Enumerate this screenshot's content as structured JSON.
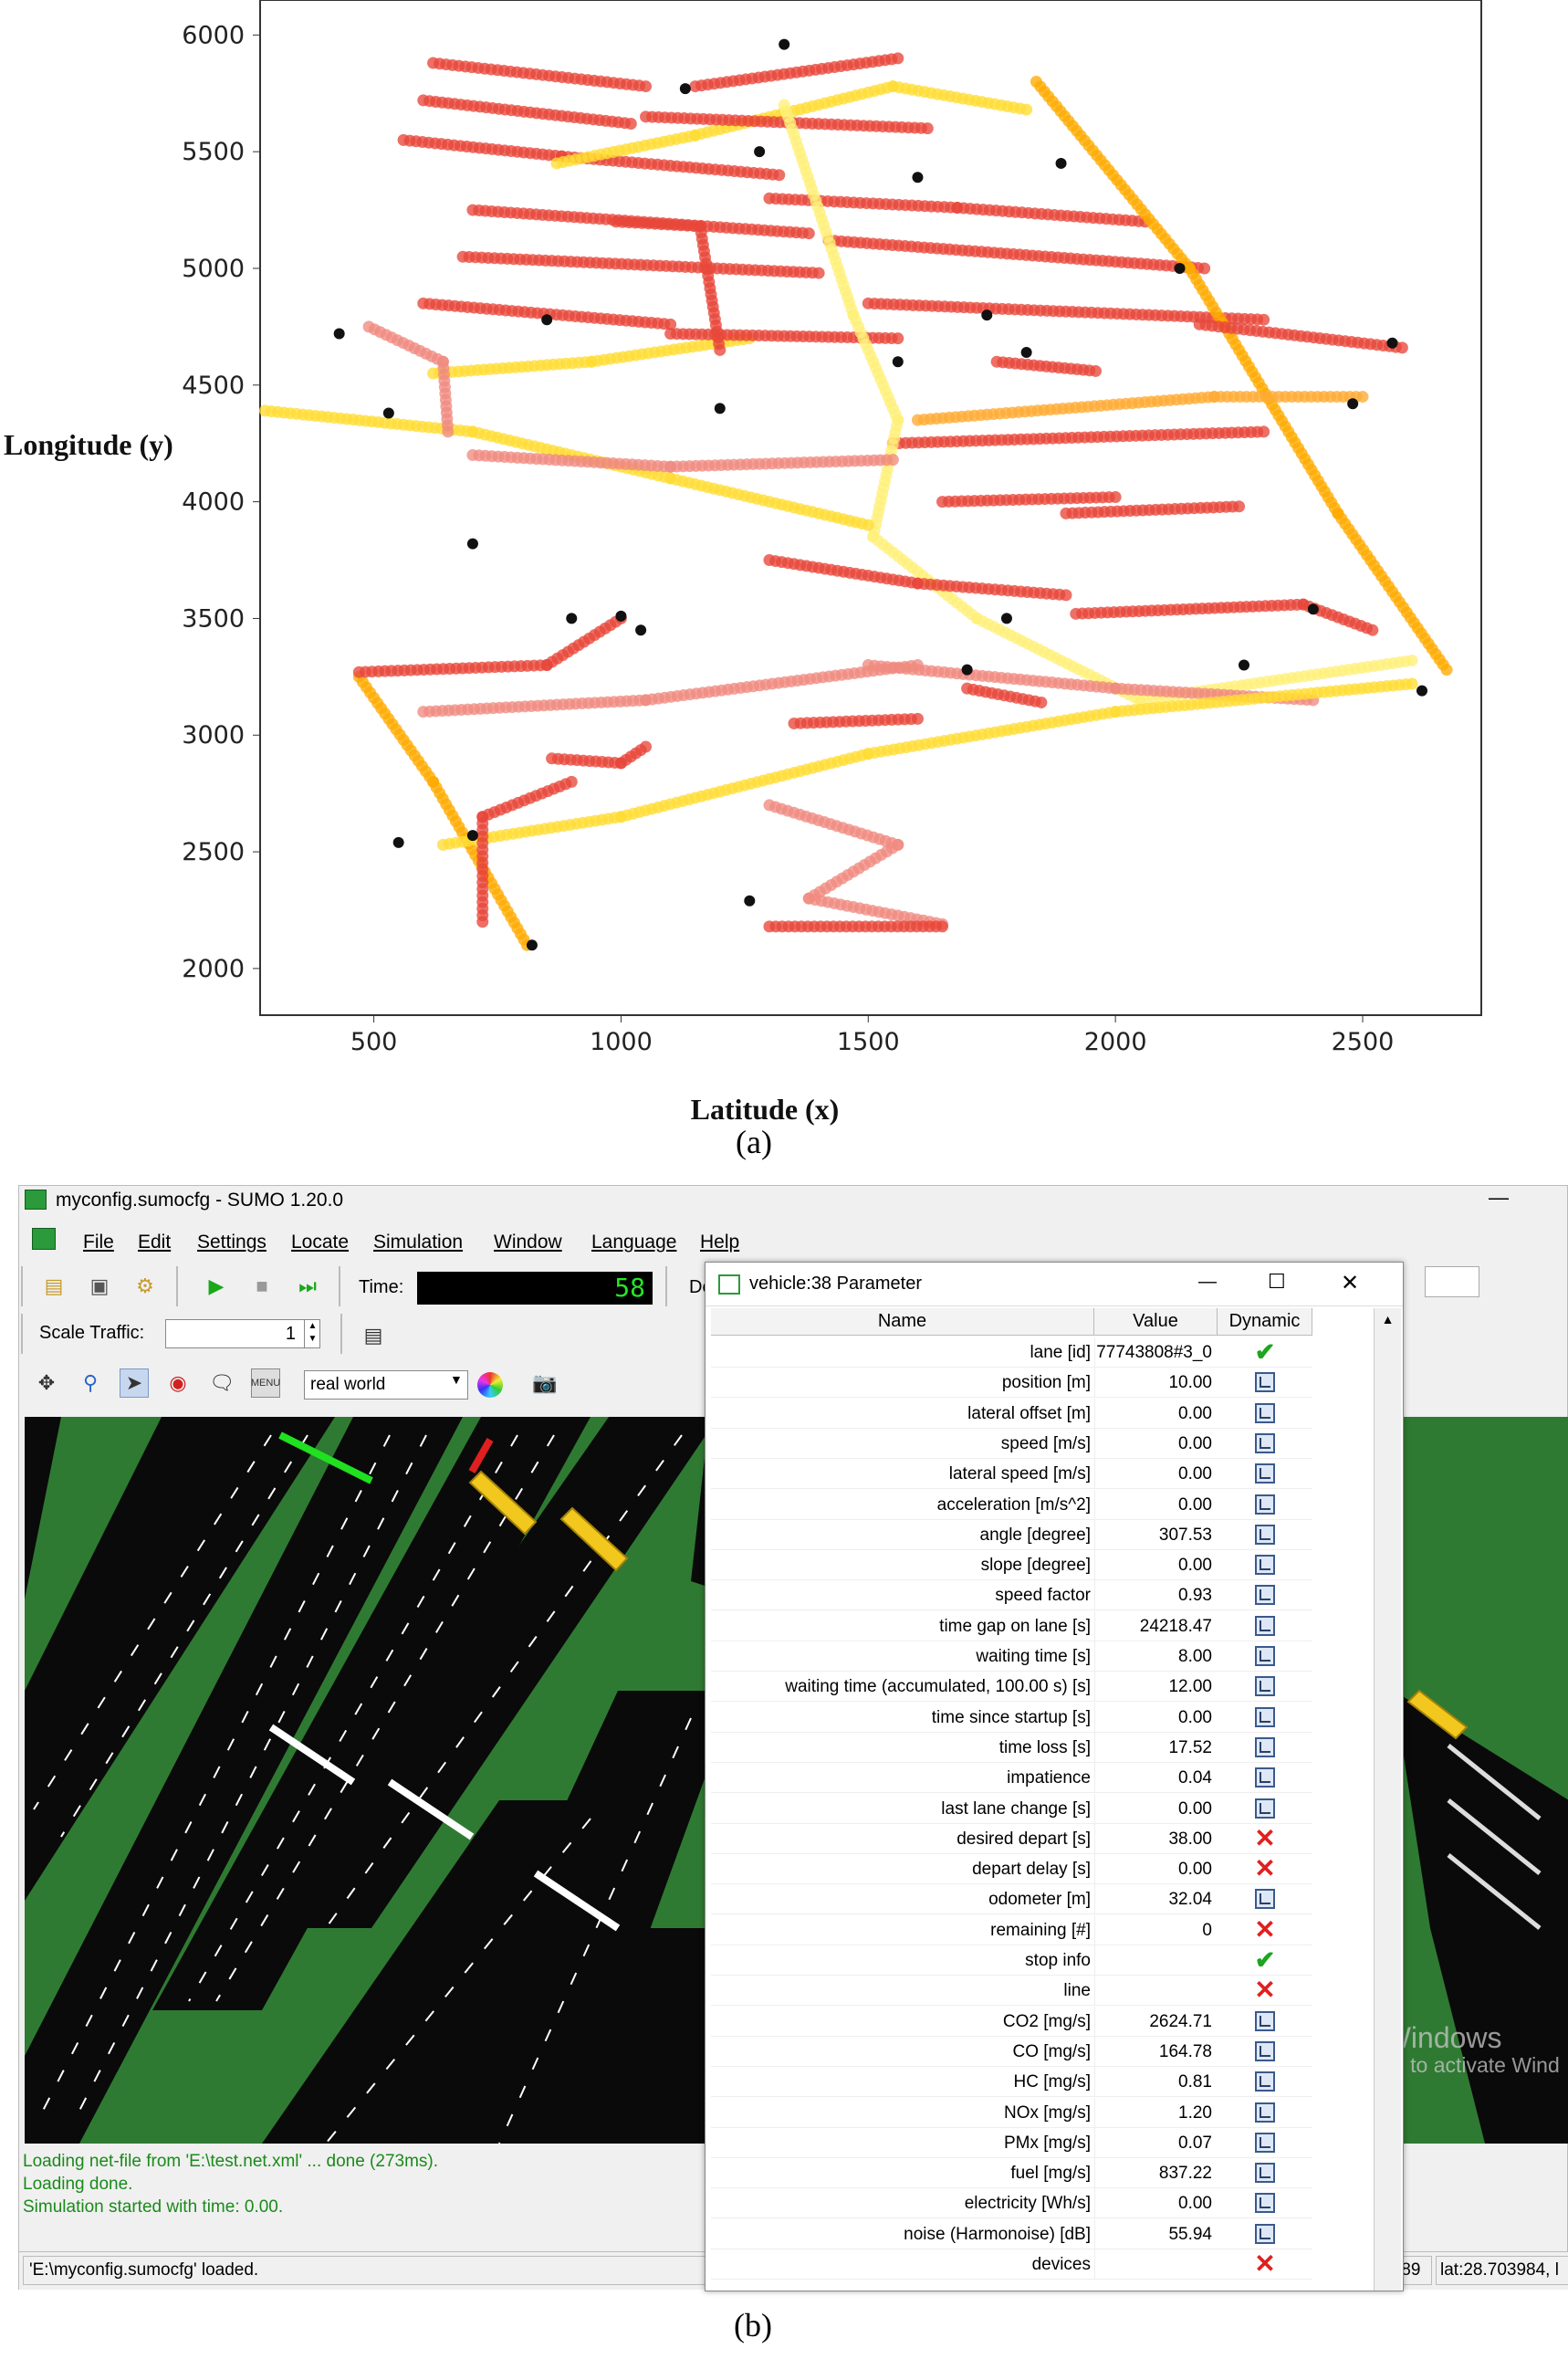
{
  "panel_a": {
    "label": "(a)",
    "chart_data": {
      "type": "scatter",
      "title": "",
      "xlabel": "Latitude (x)",
      "ylabel": "Longitude (y)",
      "xlim": [
        270,
        2740
      ],
      "ylim": [
        1800,
        6150
      ],
      "xticks": [
        500,
        1000,
        1500,
        2000,
        2500
      ],
      "yticks": [
        2000,
        2500,
        3000,
        3500,
        4000,
        4500,
        5000,
        5500,
        6000
      ],
      "grid": false,
      "color_scale": [
        "#f7c9c9",
        "#e83a2a",
        "#ffea4a",
        "#ffb000"
      ],
      "description_paths": [
        {
          "color": "#e8463a",
          "pts": [
            [
              620,
              5880
            ],
            [
              1050,
              5780
            ]
          ]
        },
        {
          "color": "#e8463a",
          "pts": [
            [
              600,
              5720
            ],
            [
              1020,
              5620
            ]
          ]
        },
        {
          "color": "#e8463a",
          "pts": [
            [
              560,
              5550
            ],
            [
              880,
              5480
            ],
            [
              1320,
              5400
            ]
          ]
        },
        {
          "color": "#ffdd33",
          "pts": [
            [
              870,
              5450
            ],
            [
              1150,
              5570
            ],
            [
              1550,
              5780
            ],
            [
              1820,
              5680
            ]
          ]
        },
        {
          "color": "#e8463a",
          "pts": [
            [
              1150,
              5780
            ],
            [
              1560,
              5900
            ]
          ]
        },
        {
          "color": "#e8463a",
          "pts": [
            [
              1050,
              5650
            ],
            [
              1620,
              5600
            ]
          ]
        },
        {
          "color": "#e8463a",
          "pts": [
            [
              700,
              5250
            ],
            [
              1380,
              5150
            ]
          ]
        },
        {
          "color": "#e8463a",
          "pts": [
            [
              680,
              5050
            ],
            [
              1400,
              4980
            ]
          ]
        },
        {
          "color": "#e8463a",
          "pts": [
            [
              600,
              4850
            ],
            [
              1100,
              4760
            ]
          ]
        },
        {
          "color": "#ffdd33",
          "pts": [
            [
              620,
              4550
            ],
            [
              940,
              4600
            ],
            [
              1260,
              4700
            ]
          ]
        },
        {
          "color": "#e8463a",
          "pts": [
            [
              1100,
              4720
            ],
            [
              1560,
              4700
            ]
          ]
        },
        {
          "color": "#e8463a",
          "pts": [
            [
              1300,
              5300
            ],
            [
              1680,
              5260
            ],
            [
              2060,
              5200
            ]
          ]
        },
        {
          "color": "#e8463a",
          "pts": [
            [
              1420,
              5120
            ],
            [
              2180,
              5000
            ]
          ]
        },
        {
          "color": "#e8463a",
          "pts": [
            [
              1500,
              4850
            ],
            [
              2300,
              4780
            ]
          ]
        },
        {
          "color": "#ffaa00",
          "pts": [
            [
              1840,
              5800
            ],
            [
              2150,
              5000
            ],
            [
              2450,
              3950
            ],
            [
              2670,
              3280
            ]
          ]
        },
        {
          "color": "#e8463a",
          "pts": [
            [
              2170,
              4760
            ],
            [
              2580,
              4660
            ]
          ]
        },
        {
          "color": "#ffaa33",
          "pts": [
            [
              1600,
              4350
            ],
            [
              2200,
              4450
            ],
            [
              2500,
              4450
            ]
          ]
        },
        {
          "color": "#e8463a",
          "pts": [
            [
              1550,
              4250
            ],
            [
              2300,
              4300
            ]
          ]
        },
        {
          "color": "#fff07a",
          "pts": [
            [
              1330,
              5700
            ],
            [
              1470,
              4800
            ],
            [
              1560,
              4350
            ],
            [
              1510,
              3850
            ],
            [
              1720,
              3500
            ],
            [
              2050,
              3150
            ],
            [
              2600,
              3320
            ]
          ]
        },
        {
          "color": "#ffdd33",
          "pts": [
            [
              280,
              4390
            ],
            [
              700,
              4300
            ],
            [
              1100,
              4100
            ],
            [
              1500,
              3900
            ]
          ]
        },
        {
          "color": "#f08a80",
          "pts": [
            [
              700,
              4200
            ],
            [
              1100,
              4150
            ],
            [
              1550,
              4180
            ]
          ]
        },
        {
          "color": "#e8463a",
          "pts": [
            [
              1300,
              3750
            ],
            [
              1600,
              3650
            ],
            [
              1900,
              3600
            ]
          ]
        },
        {
          "color": "#e8463a",
          "pts": [
            [
              1920,
              3520
            ],
            [
              2380,
              3560
            ],
            [
              2520,
              3450
            ]
          ]
        },
        {
          "color": "#e8463a",
          "pts": [
            [
              1900,
              3950
            ],
            [
              2250,
              3980
            ]
          ]
        },
        {
          "color": "#f08a80",
          "pts": [
            [
              1500,
              3300
            ],
            [
              2000,
              3200
            ],
            [
              2400,
              3150
            ]
          ]
        },
        {
          "color": "#f08a80",
          "pts": [
            [
              600,
              3100
            ],
            [
              1050,
              3150
            ],
            [
              1600,
              3300
            ]
          ]
        },
        {
          "color": "#ffaa00",
          "pts": [
            [
              470,
              3250
            ],
            [
              620,
              2800
            ],
            [
              810,
              2100
            ]
          ]
        },
        {
          "color": "#ffdd33",
          "pts": [
            [
              640,
              2530
            ],
            [
              1000,
              2650
            ],
            [
              1500,
              2920
            ],
            [
              2000,
              3100
            ],
            [
              2600,
              3220
            ]
          ]
        },
        {
          "color": "#e8463a",
          "pts": [
            [
              470,
              3270
            ],
            [
              850,
              3300
            ],
            [
              1000,
              3500
            ]
          ]
        },
        {
          "color": "#f08a80",
          "pts": [
            [
              1300,
              2700
            ],
            [
              1560,
              2530
            ],
            [
              1380,
              2300
            ],
            [
              1650,
              2190
            ]
          ]
        },
        {
          "color": "#e8463a",
          "pts": [
            [
              1300,
              2180
            ],
            [
              1650,
              2180
            ]
          ]
        },
        {
          "color": "#e8463a",
          "pts": [
            [
              720,
              2200
            ],
            [
              720,
              2650
            ],
            [
              900,
              2800
            ]
          ]
        },
        {
          "color": "#e8463a",
          "pts": [
            [
              860,
              2900
            ],
            [
              1000,
              2880
            ],
            [
              1050,
              2950
            ]
          ]
        },
        {
          "color": "#e8463a",
          "pts": [
            [
              1350,
              3050
            ],
            [
              1600,
              3070
            ]
          ]
        },
        {
          "color": "#e8463a",
          "pts": [
            [
              1700,
              3200
            ],
            [
              1850,
              3140
            ]
          ]
        },
        {
          "color": "#f08a80",
          "pts": [
            [
              490,
              4750
            ],
            [
              640,
              4600
            ],
            [
              650,
              4300
            ]
          ]
        },
        {
          "color": "#e8463a",
          "pts": [
            [
              990,
              5200
            ],
            [
              1160,
              5180
            ],
            [
              1200,
              4650
            ]
          ]
        },
        {
          "color": "#e8463a",
          "pts": [
            [
              1760,
              4600
            ],
            [
              1960,
              4560
            ]
          ]
        },
        {
          "color": "#e8463a",
          "pts": [
            [
              1650,
              4000
            ],
            [
              2000,
              4020
            ]
          ]
        }
      ],
      "endpoint_markers": [
        [
          550,
          2540
        ],
        [
          700,
          2570
        ],
        [
          820,
          2100
        ],
        [
          900,
          3500
        ],
        [
          1000,
          3510
        ],
        [
          1040,
          3450
        ],
        [
          1700,
          3280
        ],
        [
          2260,
          3300
        ],
        [
          2400,
          3540
        ],
        [
          2620,
          3190
        ],
        [
          2560,
          4680
        ],
        [
          2480,
          4420
        ],
        [
          1820,
          4640
        ],
        [
          1330,
          5960
        ],
        [
          1600,
          5390
        ],
        [
          1890,
          5450
        ],
        [
          2130,
          5000
        ],
        [
          1740,
          4800
        ],
        [
          1560,
          4600
        ],
        [
          700,
          3820
        ],
        [
          430,
          4720
        ],
        [
          530,
          4380
        ],
        [
          1130,
          5770
        ],
        [
          1280,
          5500
        ],
        [
          1200,
          4400
        ],
        [
          1780,
          3500
        ],
        [
          1260,
          2290
        ],
        [
          850,
          4780
        ]
      ]
    }
  },
  "panel_b": {
    "label": "(b)",
    "window": {
      "title": "myconfig.sumocfg - SUMO 1.20.0",
      "minimize": "—",
      "menu": [
        "File",
        "Edit",
        "Settings",
        "Locate",
        "Simulation",
        "Window",
        "Language",
        "Help"
      ],
      "time_label": "Time:",
      "time_value": "58",
      "delay_label": "Del",
      "scale_label": "Scale Traffic:",
      "scale_value": "1",
      "view_scheme": "real world",
      "messages": [
        "Loading net-file from 'E:\\test.net.xml' ... done (273ms).",
        "Loading done.",
        "Simulation started with time: 0.00."
      ],
      "status_left": "'E:\\myconfig.sumocfg' loaded.",
      "status_mid": ".89",
      "status_right": "lat:28.703984, l",
      "watermark_1": "Activate Windows",
      "watermark_2": "Go to Settings to activate Wind"
    },
    "dialog": {
      "title": "vehicle:38 Parameter",
      "minimize": "—",
      "maximize": "☐",
      "close": "✕",
      "col_name": "Name",
      "col_value": "Value",
      "col_dynamic": "Dynamic",
      "rows": [
        {
          "name": "lane [id]",
          "value": "77743808#3_0",
          "dyn": "check"
        },
        {
          "name": "position [m]",
          "value": "10.00",
          "dyn": "plot"
        },
        {
          "name": "lateral offset [m]",
          "value": "0.00",
          "dyn": "plot"
        },
        {
          "name": "speed [m/s]",
          "value": "0.00",
          "dyn": "plot"
        },
        {
          "name": "lateral speed [m/s]",
          "value": "0.00",
          "dyn": "plot"
        },
        {
          "name": "acceleration [m/s^2]",
          "value": "0.00",
          "dyn": "plot"
        },
        {
          "name": "angle [degree]",
          "value": "307.53",
          "dyn": "plot"
        },
        {
          "name": "slope [degree]",
          "value": "0.00",
          "dyn": "plot"
        },
        {
          "name": "speed factor",
          "value": "0.93",
          "dyn": "plot"
        },
        {
          "name": "time gap on lane [s]",
          "value": "24218.47",
          "dyn": "plot"
        },
        {
          "name": "waiting time [s]",
          "value": "8.00",
          "dyn": "plot"
        },
        {
          "name": "waiting time (accumulated, 100.00 s) [s]",
          "value": "12.00",
          "dyn": "plot"
        },
        {
          "name": "time since startup [s]",
          "value": "0.00",
          "dyn": "plot"
        },
        {
          "name": "time loss [s]",
          "value": "17.52",
          "dyn": "plot"
        },
        {
          "name": "impatience",
          "value": "0.04",
          "dyn": "plot"
        },
        {
          "name": "last lane change [s]",
          "value": "0.00",
          "dyn": "plot"
        },
        {
          "name": "desired depart [s]",
          "value": "38.00",
          "dyn": "x"
        },
        {
          "name": "depart delay [s]",
          "value": "0.00",
          "dyn": "x"
        },
        {
          "name": "odometer [m]",
          "value": "32.04",
          "dyn": "plot"
        },
        {
          "name": "remaining [#]",
          "value": "0",
          "dyn": "x"
        },
        {
          "name": "stop info",
          "value": "",
          "dyn": "check"
        },
        {
          "name": "line",
          "value": "",
          "dyn": "x"
        },
        {
          "name": "CO2 [mg/s]",
          "value": "2624.71",
          "dyn": "plot"
        },
        {
          "name": "CO [mg/s]",
          "value": "164.78",
          "dyn": "plot"
        },
        {
          "name": "HC [mg/s]",
          "value": "0.81",
          "dyn": "plot"
        },
        {
          "name": "NOx [mg/s]",
          "value": "1.20",
          "dyn": "plot"
        },
        {
          "name": "PMx [mg/s]",
          "value": "0.07",
          "dyn": "plot"
        },
        {
          "name": "fuel [mg/s]",
          "value": "837.22",
          "dyn": "plot"
        },
        {
          "name": "electricity [Wh/s]",
          "value": "0.00",
          "dyn": "plot"
        },
        {
          "name": "noise (Harmonoise) [dB]",
          "value": "55.94",
          "dyn": "plot"
        },
        {
          "name": "devices",
          "value": "",
          "dyn": "x"
        }
      ]
    }
  }
}
